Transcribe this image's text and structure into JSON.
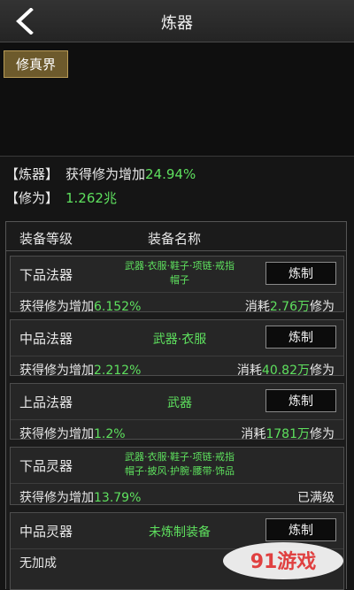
{
  "header": {
    "title": "炼器"
  },
  "realm": {
    "tab_label": "修真界"
  },
  "stats": {
    "refine_tag": "【炼器】",
    "refine_prefix": "获得修为增加",
    "refine_value": "24.94%",
    "cultivation_tag": "【修为】",
    "cultivation_value": "1.262兆"
  },
  "list": {
    "col_grade": "装备等级",
    "col_name": "装备名称",
    "craft_label": "炼制",
    "items": [
      {
        "grade": "下品法器",
        "names": [
          "武器·衣服·鞋子·项链·戒指",
          "帽子"
        ],
        "gain_prefix": "获得修为增加",
        "gain": "6.152%",
        "cost_prefix": "消耗",
        "cost": "2.76万",
        "cost_suffix": "修为"
      },
      {
        "grade": "中品法器",
        "names": [
          "武器·衣服"
        ],
        "gain_prefix": "获得修为增加",
        "gain": "2.212%",
        "cost_prefix": "消耗",
        "cost": "40.82万",
        "cost_suffix": "修为"
      },
      {
        "grade": "上品法器",
        "names": [
          "武器"
        ],
        "gain_prefix": "获得修为增加",
        "gain": "1.2%",
        "cost_prefix": "消耗",
        "cost": "1781万",
        "cost_suffix": "修为"
      },
      {
        "grade": "下品灵器",
        "names": [
          "武器·衣服·鞋子·项链·戒指",
          "帽子·披风·护腕·腰带·饰品"
        ],
        "gain_prefix": "获得修为增加",
        "gain": "13.79%",
        "status": "已满级"
      },
      {
        "grade": "中品灵器",
        "names": [
          "未炼制装备"
        ],
        "no_bonus": "无加成"
      }
    ]
  },
  "watermark": {
    "text": "91游戏"
  },
  "colors": {
    "accent_green": "#5ee05e",
    "tab_gold": "#6d5a2c"
  }
}
